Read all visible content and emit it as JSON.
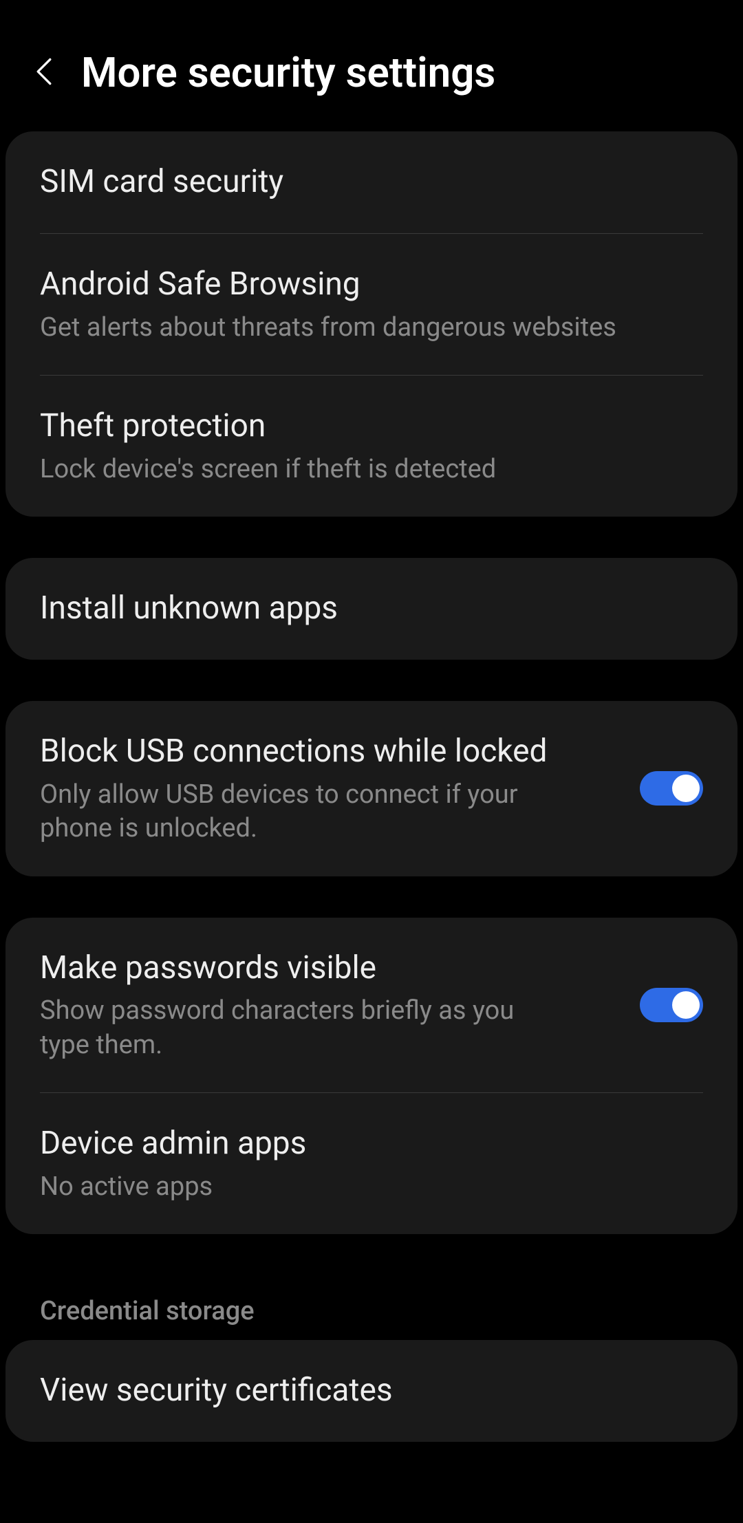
{
  "header": {
    "title": "More security settings"
  },
  "group1": {
    "items": [
      {
        "title": "SIM card security",
        "subtitle": null
      },
      {
        "title": "Android Safe Browsing",
        "subtitle": "Get alerts about threats from dangerous websites"
      },
      {
        "title": "Theft protection",
        "subtitle": "Lock device's screen if theft is detected"
      }
    ]
  },
  "group2": {
    "items": [
      {
        "title": "Install unknown apps",
        "subtitle": null
      }
    ]
  },
  "group3": {
    "items": [
      {
        "title": "Block USB connections while locked",
        "subtitle": "Only allow USB devices to connect if your phone is unlocked.",
        "toggle": true
      }
    ]
  },
  "group4": {
    "items": [
      {
        "title": "Make passwords visible",
        "subtitle": "Show password characters briefly as you type them.",
        "toggle": true
      },
      {
        "title": "Device admin apps",
        "subtitle": "No active apps"
      }
    ]
  },
  "section_header": "Credential storage",
  "group5": {
    "items": [
      {
        "title": "View security certificates",
        "subtitle": null
      }
    ]
  }
}
